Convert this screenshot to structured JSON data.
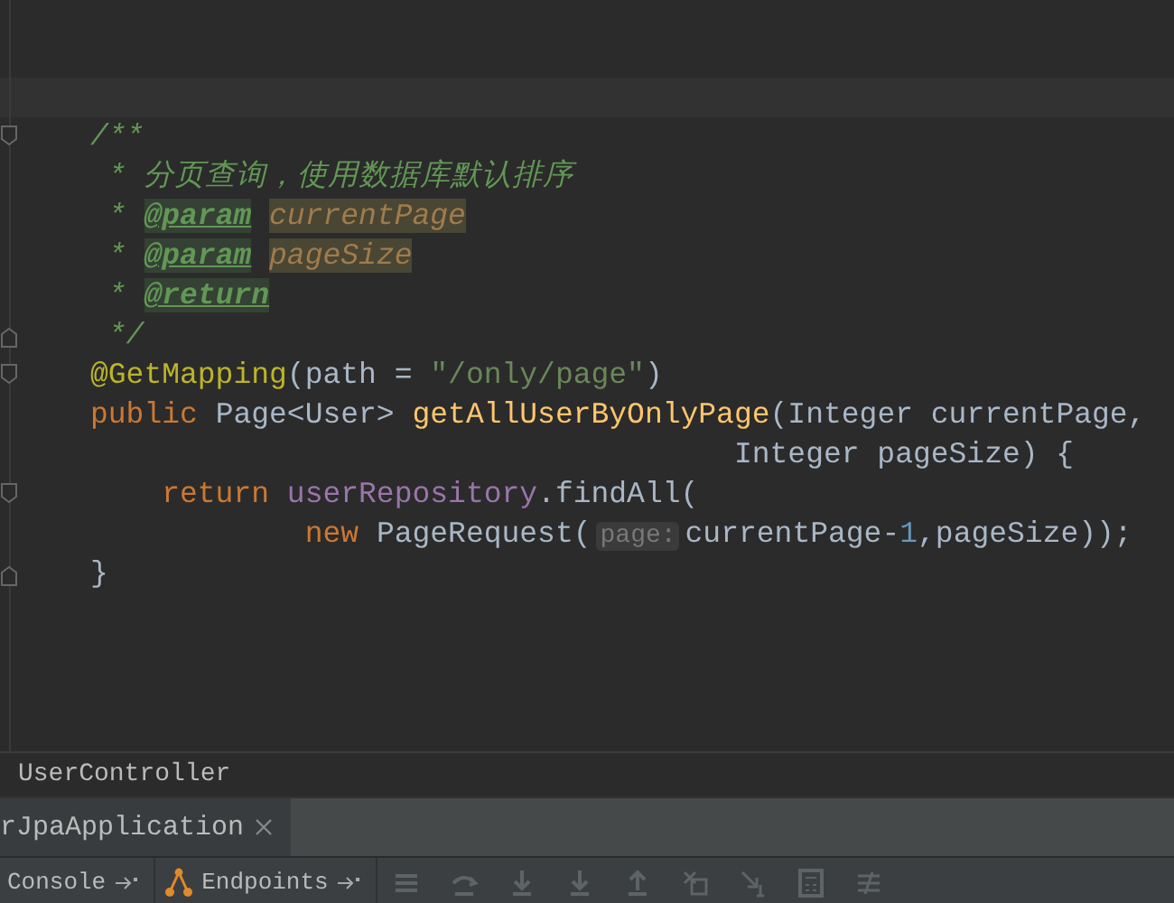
{
  "editor": {
    "lines": [
      {
        "fold_start": true,
        "fold_end": false,
        "tokens": [
          {
            "kind": "comment",
            "text": "/**"
          }
        ]
      },
      {
        "fold_start": false,
        "fold_end": false,
        "tokens": [
          {
            "kind": "comment",
            "text": " * 分页查询，使用数据库默认排序"
          }
        ]
      },
      {
        "fold_start": false,
        "fold_end": false,
        "tokens": [
          {
            "kind": "comment",
            "text": " * "
          },
          {
            "kind": "doc_tag",
            "text": "@param"
          },
          {
            "kind": "doc_param",
            "text": "currentPage"
          }
        ]
      },
      {
        "fold_start": false,
        "fold_end": false,
        "tokens": [
          {
            "kind": "comment",
            "text": " * "
          },
          {
            "kind": "doc_tag",
            "text": "@param"
          },
          {
            "kind": "doc_param",
            "text": "pageSize"
          }
        ]
      },
      {
        "fold_start": false,
        "fold_end": false,
        "tokens": [
          {
            "kind": "comment",
            "text": " * "
          },
          {
            "kind": "doc_tag",
            "text": "@return"
          }
        ]
      },
      {
        "fold_start": false,
        "fold_end": true,
        "tokens": [
          {
            "kind": "comment",
            "text": " */"
          }
        ]
      },
      {
        "fold_start": true,
        "fold_end": false,
        "tokens": [
          {
            "kind": "annotation",
            "text": "@GetMapping"
          },
          {
            "kind": "plain",
            "text": "(path = "
          },
          {
            "kind": "string",
            "text": "\"/only/page\""
          },
          {
            "kind": "plain",
            "text": ")"
          }
        ]
      },
      {
        "fold_start": false,
        "fold_end": false,
        "tokens": [
          {
            "kind": "keyword",
            "text": "public "
          },
          {
            "kind": "plain",
            "text": "Page<User> "
          },
          {
            "kind": "method",
            "text": "getAllUserByOnlyPage"
          },
          {
            "kind": "plain",
            "text": "(Integer currentPage,"
          }
        ]
      },
      {
        "fold_start": false,
        "fold_end": false,
        "tokens": [
          {
            "kind": "plain",
            "text": "                                    Integer pageSize) {"
          }
        ]
      },
      {
        "fold_start": true,
        "fold_end": false,
        "tokens": [
          {
            "kind": "keyword",
            "text": "    return "
          },
          {
            "kind": "field",
            "text": "userRepository"
          },
          {
            "kind": "plain",
            "text": ".findAll("
          }
        ]
      },
      {
        "fold_start": false,
        "fold_end": false,
        "tokens": [
          {
            "kind": "keyword",
            "text": "            new "
          },
          {
            "kind": "plain",
            "text": "PageRequest("
          },
          {
            "kind": "hint",
            "text": "page:"
          },
          {
            "kind": "plain",
            "text": "currentPage-"
          },
          {
            "kind": "number",
            "text": "1"
          },
          {
            "kind": "plain",
            "text": ",pageSize));"
          }
        ]
      },
      {
        "fold_start": false,
        "fold_end": true,
        "tokens": [
          {
            "kind": "plain",
            "text": "}"
          }
        ]
      }
    ]
  },
  "breadcrumb": "UserController",
  "run_tabs": [
    {
      "label": "rJpaApplication",
      "selected": true
    }
  ],
  "toolbar": {
    "tabs": [
      {
        "label": "Console",
        "kind": "console"
      },
      {
        "label": "Endpoints",
        "kind": "endpoints"
      }
    ]
  }
}
